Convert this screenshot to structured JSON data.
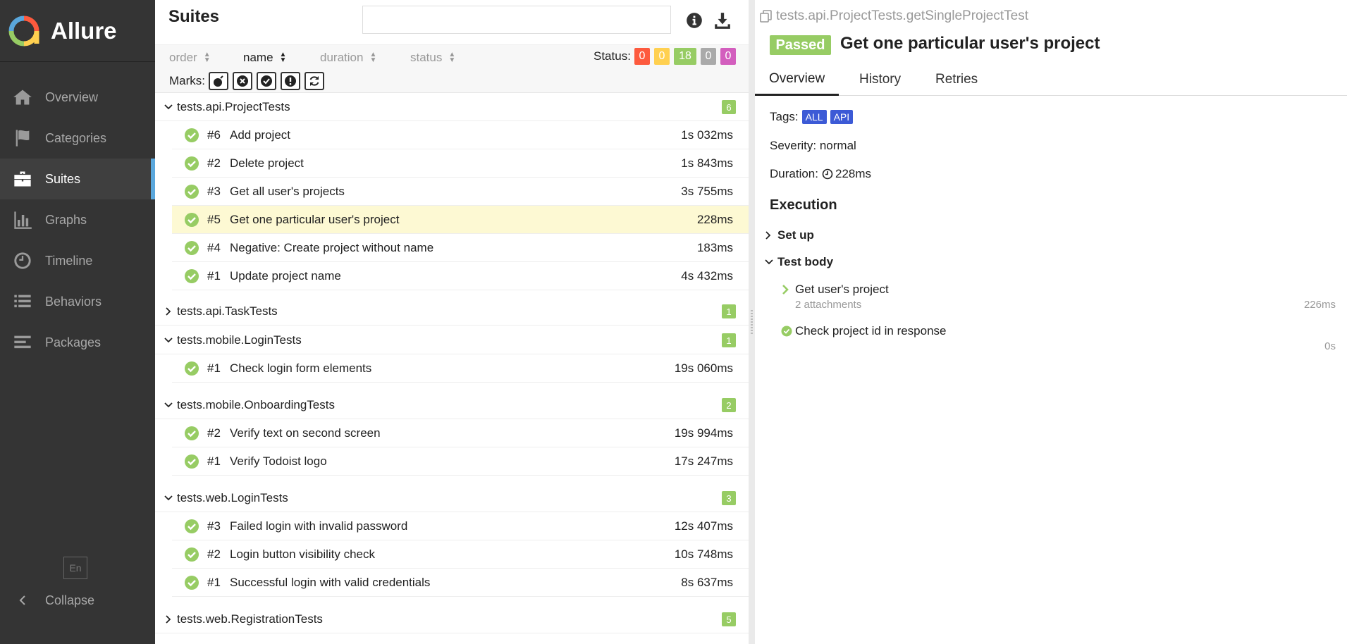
{
  "sidebar": {
    "brand": "Allure",
    "items": [
      {
        "label": "Overview",
        "icon": "home-icon"
      },
      {
        "label": "Categories",
        "icon": "flag-icon"
      },
      {
        "label": "Suites",
        "icon": "briefcase-icon",
        "active": true
      },
      {
        "label": "Graphs",
        "icon": "bar-chart-icon"
      },
      {
        "label": "Timeline",
        "icon": "clock-icon"
      },
      {
        "label": "Behaviors",
        "icon": "list-icon"
      },
      {
        "label": "Packages",
        "icon": "align-left-icon"
      }
    ],
    "language": "En",
    "collapse_label": "Collapse"
  },
  "suites": {
    "title": "Suites",
    "search": {
      "value": "",
      "placeholder": ""
    },
    "sort": {
      "order": "order",
      "name": "name",
      "duration": "duration",
      "status": "status",
      "active": "name"
    },
    "status_label": "Status:",
    "status_counts": [
      {
        "status": "failed",
        "count": "0",
        "color": "#fd5a3e"
      },
      {
        "status": "broken",
        "count": "0",
        "color": "#ffd050"
      },
      {
        "status": "passed",
        "count": "18",
        "color": "#97cc64"
      },
      {
        "status": "skipped",
        "count": "0",
        "color": "#aaaaaa"
      },
      {
        "status": "unknown",
        "count": "0",
        "color": "#d35ebe"
      }
    ],
    "marks_label": "Marks:",
    "marks": [
      "bomb-icon",
      "x-circle-icon",
      "check-circle-icon",
      "exclamation-icon",
      "retry-icon"
    ],
    "groups": [
      {
        "name": "tests.api.ProjectTests",
        "count": "6",
        "expanded": true,
        "tests": [
          {
            "num": "#6",
            "name": "Add project",
            "duration": "1s 032ms"
          },
          {
            "num": "#2",
            "name": "Delete project",
            "duration": "1s 843ms"
          },
          {
            "num": "#3",
            "name": "Get all user's projects",
            "duration": "3s 755ms"
          },
          {
            "num": "#5",
            "name": "Get one particular user's project",
            "duration": "228ms",
            "selected": true
          },
          {
            "num": "#4",
            "name": "Negative: Create project without name",
            "duration": "183ms"
          },
          {
            "num": "#1",
            "name": "Update project name",
            "duration": "4s 432ms"
          }
        ]
      },
      {
        "name": "tests.api.TaskTests",
        "count": "1",
        "expanded": false,
        "tests": []
      },
      {
        "name": "tests.mobile.LoginTests",
        "count": "1",
        "expanded": true,
        "tests": [
          {
            "num": "#1",
            "name": "Check login form elements",
            "duration": "19s 060ms"
          }
        ]
      },
      {
        "name": "tests.mobile.OnboardingTests",
        "count": "2",
        "expanded": true,
        "tests": [
          {
            "num": "#2",
            "name": "Verify text on second screen",
            "duration": "19s 994ms"
          },
          {
            "num": "#1",
            "name": "Verify Todoist logo",
            "duration": "17s 247ms"
          }
        ]
      },
      {
        "name": "tests.web.LoginTests",
        "count": "3",
        "expanded": true,
        "tests": [
          {
            "num": "#3",
            "name": "Failed login with invalid password",
            "duration": "12s 407ms"
          },
          {
            "num": "#2",
            "name": "Login button visibility check",
            "duration": "10s 748ms"
          },
          {
            "num": "#1",
            "name": "Successful login with valid credentials",
            "duration": "8s 637ms"
          }
        ]
      },
      {
        "name": "tests.web.RegistrationTests",
        "count": "5",
        "expanded": false,
        "tests": []
      }
    ]
  },
  "detail": {
    "path": "tests.api.ProjectTests.getSingleProjectTest",
    "status": "Passed",
    "title": "Get one particular user's project",
    "tabs": [
      "Overview",
      "History",
      "Retries"
    ],
    "tags_label": "Tags:",
    "tags": [
      "ALL",
      "API"
    ],
    "severity": "Severity: normal",
    "duration_label": "Duration:",
    "duration": "228ms",
    "execution_title": "Execution",
    "setup_label": "Set up",
    "testbody_label": "Test body",
    "steps": [
      {
        "name": "Get user's project",
        "attachments": "2 attachments",
        "duration": "226ms"
      },
      {
        "name": "Check project id in response",
        "duration": "0s"
      }
    ]
  }
}
